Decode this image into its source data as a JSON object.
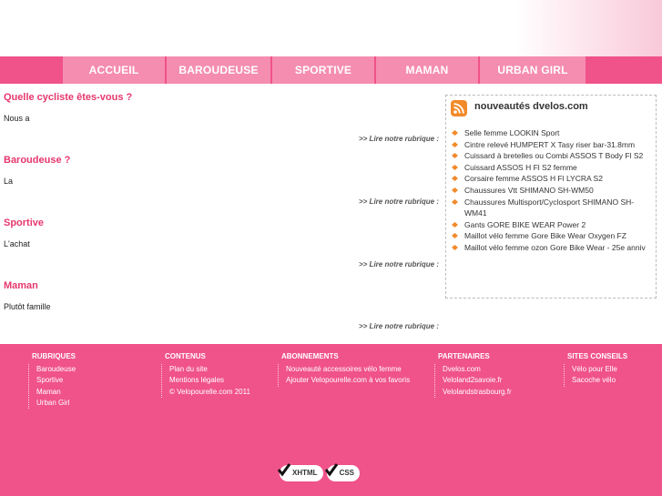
{
  "nav": {
    "items": [
      {
        "label": "ACCUEIL"
      },
      {
        "label": "BAROUDEUSE"
      },
      {
        "label": "SPORTIVE"
      },
      {
        "label": "MAMAN"
      },
      {
        "label": "URBAN GIRL"
      }
    ]
  },
  "sections": [
    {
      "title": "Quelle cycliste êtes-vous ?",
      "text": "Nous a",
      "link": ">> Lire notre rubrique :"
    },
    {
      "title": "Baroudeuse ?",
      "text": "La",
      "link": ">> Lire notre rubrique :"
    },
    {
      "title": "Sportive",
      "text": "L'achat",
      "link": ">> Lire notre rubrique :"
    },
    {
      "title": "Maman",
      "text": "Plutôt famille",
      "link": ">> Lire notre rubrique :"
    }
  ],
  "rss": {
    "title": "nouveautés dvelos.com",
    "icon": "rss-icon",
    "items": [
      "Selle femme LOOKIN Sport",
      "Cintre relevé HUMPERT X Tasy riser bar-31.8mm",
      "Cuissard à bretelles ou Combi ASSOS T Body Fl S2",
      "Cuissard ASSOS H Fl S2 femme",
      "Corsaire femme ASSOS H Fl LYCRA S2",
      "Chaussures Vtt SHIMANO SH-WM50",
      "Chaussures Multisport/Cyclosport SHIMANO SH-WM41",
      "Gants GORE BIKE WEAR Power 2",
      "Maillot vélo femme Gore Bike Wear Oxygen FZ",
      "Maillot vélo femme ozon Gore Bike Wear - 25e anniv"
    ]
  },
  "footer": {
    "columns": [
      {
        "heading": "RUBRIQUES",
        "items": [
          "Baroudeuse",
          "Sportive",
          "Maman",
          "Urban Girl"
        ]
      },
      {
        "heading": "CONTENUS",
        "items": [
          "Plan du site",
          "Mentions légales",
          "© Velopourelle.com 2011"
        ]
      },
      {
        "heading": "ABONNEMENTS",
        "items": [
          "Nouveauté accessoires vélo femme",
          "Ajouter Velopourelle.com à vos favoris"
        ]
      },
      {
        "heading": "PARTENAIRES",
        "items": [
          "Dvelos.com",
          "Veloland2savoie.fr",
          "Velolandstrasbourg.fr"
        ]
      },
      {
        "heading": "SITES CONSEILS",
        "items": [
          "Vélo pour Elle",
          "Sacoche vélo"
        ]
      }
    ],
    "badges": [
      {
        "label": "XHTML"
      },
      {
        "label": "CSS"
      }
    ]
  },
  "colors": {
    "brand_pink": "#f0528a",
    "nav_tab": "#f58db0",
    "title_pink": "#e6386e",
    "rss_orange": "#f28a2a"
  }
}
